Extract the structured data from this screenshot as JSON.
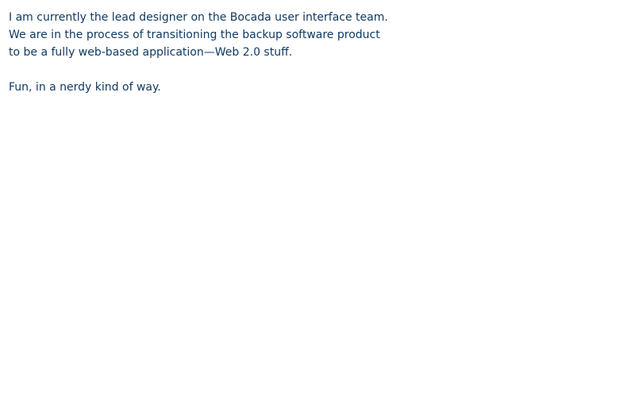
{
  "text": {
    "paragraph_1_lines": [
      "I am currently the lead designer on the Bocada user interface team.",
      "We are in the process of transitioning the backup software product",
      "to be a fully web-based application—Web 2.0 stuff."
    ],
    "paragraph_2_line": "Fun, in a nerdy kind of way."
  },
  "colors": {
    "background": "#ffffff",
    "text": "#103a63"
  }
}
